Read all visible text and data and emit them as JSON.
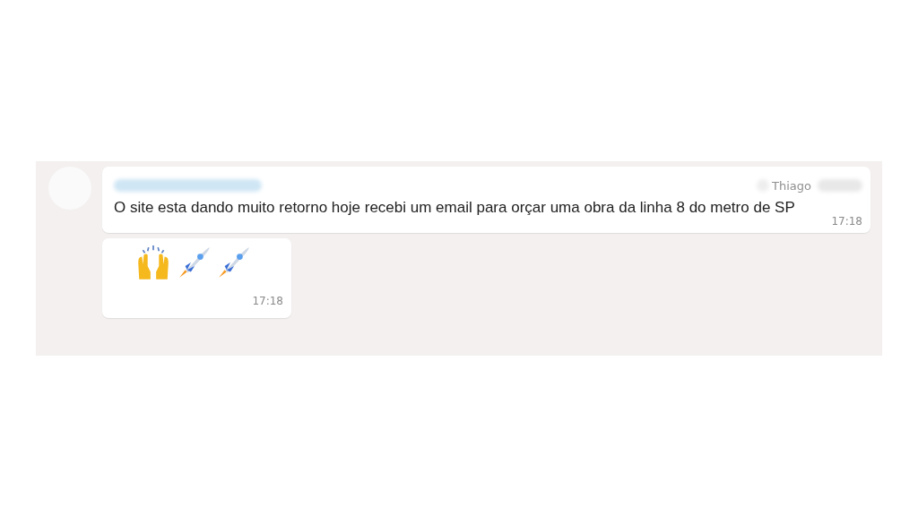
{
  "chat": {
    "messages": [
      {
        "kind": "text",
        "sender": "Thiago",
        "text": "O site esta dando muito retorno hoje recebi um email para orçar uma obra da linha 8 do metro de SP",
        "time": "17:18"
      },
      {
        "kind": "emoji",
        "emojis": [
          {
            "kind": "hands"
          },
          {
            "kind": "rocket"
          },
          {
            "kind": "rocket"
          }
        ],
        "time": "17:18"
      }
    ]
  }
}
